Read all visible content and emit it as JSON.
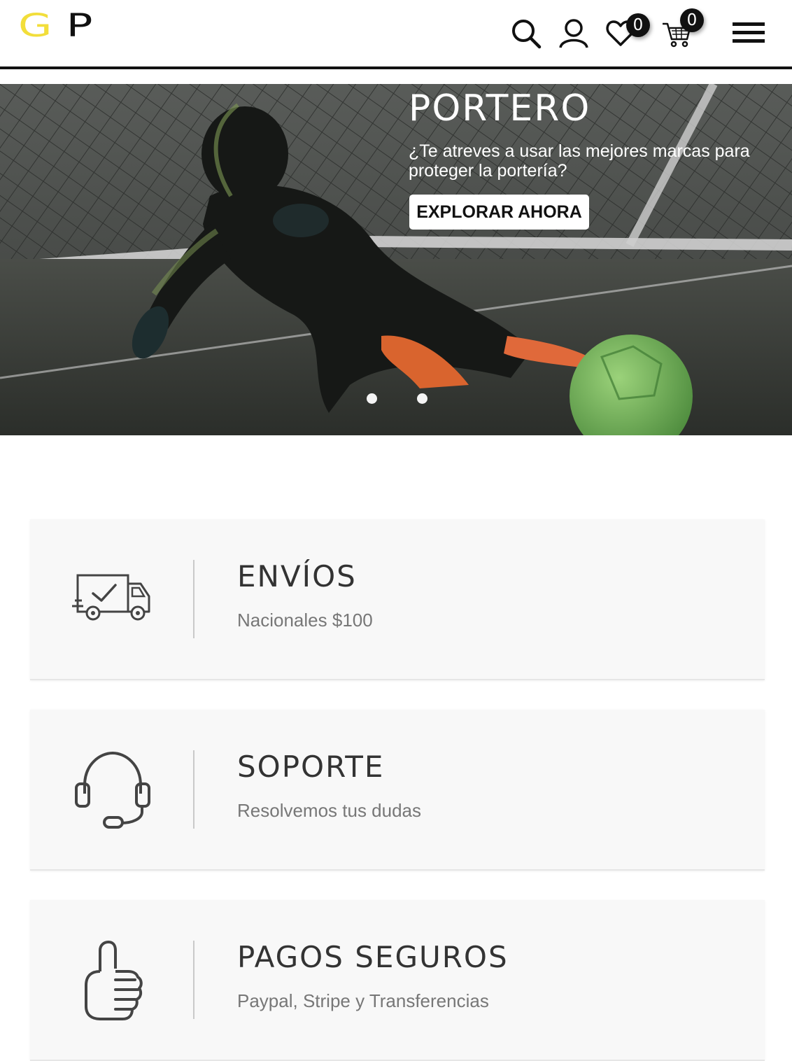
{
  "colors": {
    "logo_g": "#f2de3a",
    "logo_p": "#111111",
    "header_rule": "#111111",
    "card_bg": "#f8f8f8",
    "card_title": "#333333",
    "card_sub": "#777777",
    "icon_stroke": "#444444"
  },
  "header": {
    "logo": {
      "letter_g": "G",
      "letter_p": "P"
    },
    "icons": [
      "search-icon",
      "user-icon",
      "heart-icon",
      "cart-icon",
      "hamburger-menu-icon"
    ],
    "wishlist_count": "0",
    "cart_count": "0"
  },
  "hero": {
    "title": "PORTERO",
    "text": "¿Te atreves a usar las mejores marcas para proteger la portería?",
    "button_label": "EXPLORAR AHORA",
    "slides": 2,
    "active_slide": 1
  },
  "features": [
    {
      "icon": "truck-icon",
      "title": "ENVÍOS",
      "subtitle": "Nacionales $100"
    },
    {
      "icon": "headset-icon",
      "title": "SOPORTE",
      "subtitle": "Resolvemos tus dudas"
    },
    {
      "icon": "thumbs-up-icon",
      "title": "PAGOS SEGUROS",
      "subtitle": "Paypal, Stripe y Transferencias"
    }
  ]
}
